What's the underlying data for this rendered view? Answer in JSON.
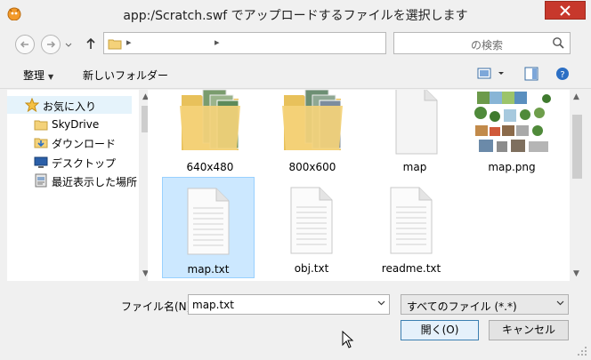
{
  "window": {
    "title": "app:/Scratch.swf でアップロードするファイルを選択します"
  },
  "nav": {
    "search_placeholder": "の検索",
    "address_chevron": "▸"
  },
  "toolbar": {
    "organize_label": "整理",
    "new_folder_label": "新しいフォルダー"
  },
  "sidebar": {
    "items": [
      {
        "label": "お気に入り",
        "icon": "star-icon"
      },
      {
        "label": "SkyDrive",
        "icon": "folder-icon"
      },
      {
        "label": "ダウンロード",
        "icon": "download-folder-icon"
      },
      {
        "label": "デスクトップ",
        "icon": "desktop-icon"
      },
      {
        "label": "最近表示した場所",
        "icon": "recent-places-icon"
      }
    ]
  },
  "files": [
    {
      "name": "640x480",
      "kind": "folder"
    },
    {
      "name": "800x600",
      "kind": "folder"
    },
    {
      "name": "map",
      "kind": "blank"
    },
    {
      "name": "map.png",
      "kind": "image"
    },
    {
      "name": "map.txt",
      "kind": "text",
      "selected": true
    },
    {
      "name": "obj.txt",
      "kind": "text"
    },
    {
      "name": "readme.txt",
      "kind": "text"
    }
  ],
  "bottom": {
    "filename_label": "ファイル名(N):",
    "filename_value": "map.txt",
    "filetype_value": "すべてのファイル (*.*)",
    "open_label": "開く(O)",
    "cancel_label": "キャンセル"
  },
  "colors": {
    "close_red": "#c7382c",
    "selection_bg": "#cce8ff",
    "selection_border": "#99d1ff",
    "folder_yellow": "#f4d27a"
  }
}
